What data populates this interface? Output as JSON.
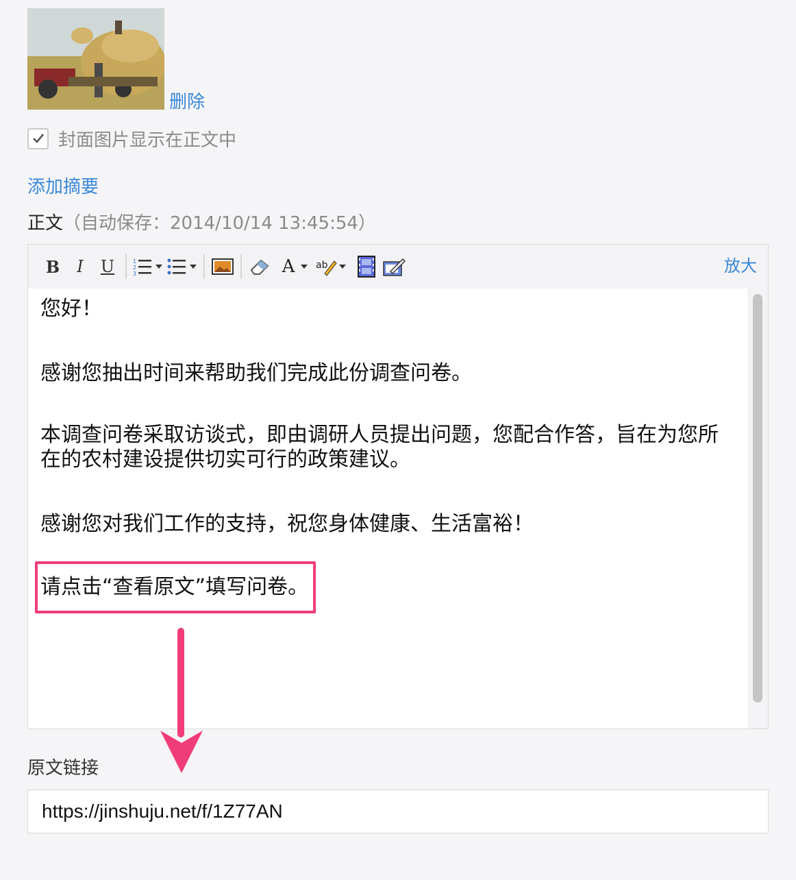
{
  "cover": {
    "delete_label": "删除",
    "show_in_body_label": "封面图片显示在正文中",
    "show_in_body_checked": true
  },
  "add_summary_label": "添加摘要",
  "body_section": {
    "label": "正文",
    "autosave_text": "（自动保存：2014/10/14 13:45:54）"
  },
  "toolbar": {
    "buttons": [
      "bold-icon",
      "italic-icon",
      "underline-icon",
      "ordered-list-icon",
      "unordered-list-icon",
      "image-icon",
      "eraser-icon",
      "font-color-icon",
      "highlight-color-icon",
      "video-icon",
      "edit-source-icon"
    ],
    "bold_label": "B",
    "italic_label": "I",
    "underline_label": "U",
    "font_color_label": "A",
    "zoom_label": "放大"
  },
  "editor": {
    "paragraphs": [
      "您好！",
      "感谢您抽出时间来帮助我们完成此份调查问卷。",
      "本调查问卷采取访谈式，即由调研人员提出问题，您配合作答，旨在为您所在的农村建设提供切实可行的政策建议。",
      "感谢您对我们工作的支持，祝您身体健康、生活富裕！",
      "请点击“查看原文”填写问卷。"
    ]
  },
  "source_link": {
    "label": "原文链接",
    "value": "https://jinshuju.net/f/1Z77AN"
  },
  "colors": {
    "link": "#3a87d8",
    "highlight": "#f03c78",
    "background": "#f5f5f7"
  }
}
